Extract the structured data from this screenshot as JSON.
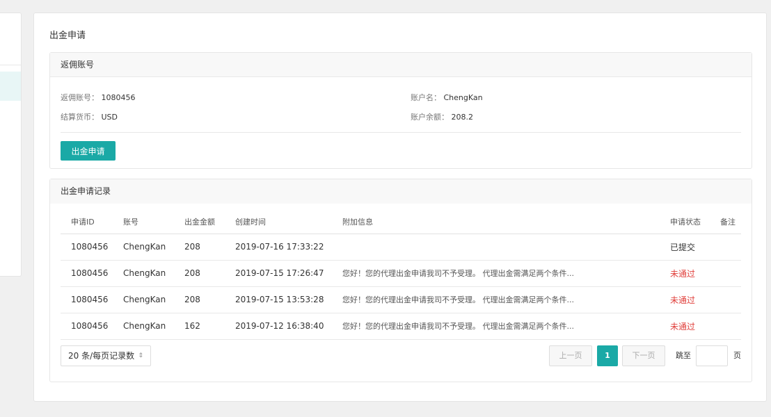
{
  "page_title": "出金申请",
  "account_card": {
    "title": "返佣账号",
    "rebate_account_label": "返佣账号：",
    "rebate_account_value": "1080456",
    "account_name_label": "账户名：",
    "account_name_value": "ChengKan",
    "currency_label": "结算货币：",
    "currency_value": "USD",
    "balance_label": "账户余额：",
    "balance_value": "208.2",
    "apply_button": "出金申请"
  },
  "records_card": {
    "title": "出金申请记录",
    "columns": [
      "申请ID",
      "账号",
      "出金金额",
      "创建时间",
      "附加信息",
      "申请状态",
      "备注"
    ],
    "rows": [
      {
        "id": "1080456",
        "account": "ChengKan",
        "amount": "208",
        "created": "2019-07-16 17:33:22",
        "message": "",
        "status": "已提交",
        "remark": ""
      },
      {
        "id": "1080456",
        "account": "ChengKan",
        "amount": "208",
        "created": "2019-07-15 17:26:47",
        "message": "您好！您的代理出金申请我司不予受理。 代理出金需满足两个条件...",
        "status": "未通过",
        "remark": ""
      },
      {
        "id": "1080456",
        "account": "ChengKan",
        "amount": "208",
        "created": "2019-07-15 13:53:28",
        "message": "您好！您的代理出金申请我司不予受理。 代理出金需满足两个条件...",
        "status": "未通过",
        "remark": ""
      },
      {
        "id": "1080456",
        "account": "ChengKan",
        "amount": "162",
        "created": "2019-07-12 16:38:40",
        "message": "您好！您的代理出金申请我司不予受理。 代理出金需满足两个条件...",
        "status": "未通过",
        "remark": ""
      }
    ]
  },
  "pagination": {
    "page_size_label": "20 条/每页记录数",
    "prev_label": "上一页",
    "current_page": "1",
    "next_label": "下一页",
    "jump_label": "跳至",
    "page_unit": "页"
  },
  "colors": {
    "accent": "#1aa9a6",
    "fail": "#e0403c"
  }
}
